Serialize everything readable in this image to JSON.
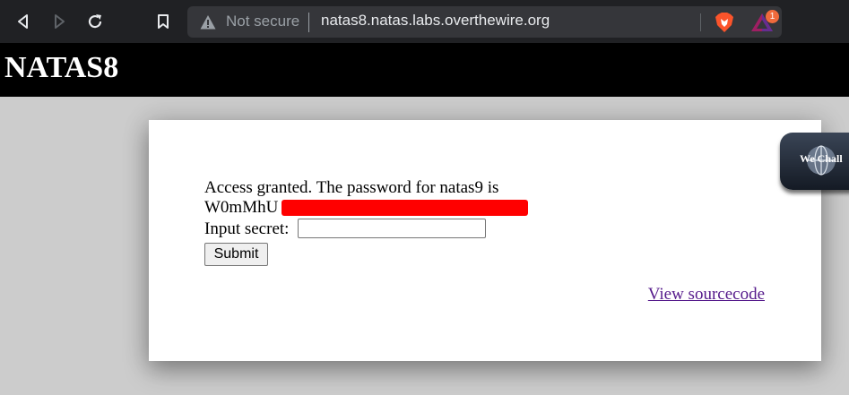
{
  "browser": {
    "security_label": "Not secure",
    "url": "natas8.natas.labs.overthewire.org",
    "rewards_badge": "1",
    "icons": [
      "back-icon",
      "forward-icon",
      "reload-icon",
      "bookmark-icon",
      "warning-icon",
      "brave-shields-icon",
      "brave-rewards-icon"
    ]
  },
  "header": {
    "title": "NATAS8"
  },
  "content": {
    "granted_text": "Access granted. The password for natas9 is",
    "password_visible": "W0mMhU",
    "input_label": "Input secret:",
    "input_value": "",
    "submit_label": "Submit",
    "source_link": "View sourcecode"
  },
  "widget": {
    "label": "We Chall"
  },
  "colors": {
    "toolbar": "#202124",
    "header": "#000000",
    "page_bg": "#cccccc",
    "redaction": "#ff0000",
    "link": "#551a8b"
  }
}
